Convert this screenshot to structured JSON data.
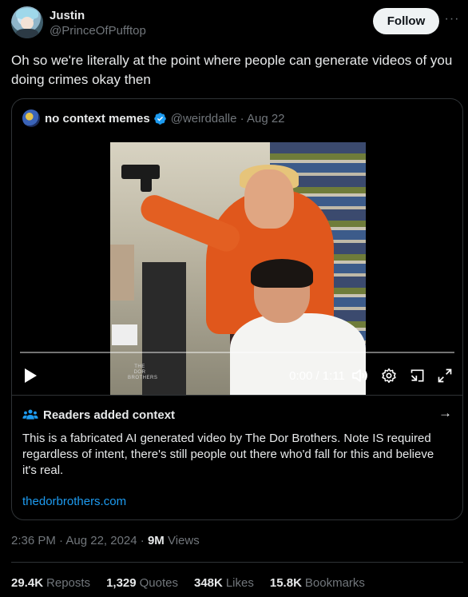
{
  "post": {
    "author_name": "Justin",
    "author_handle": "@PrinceOfPufftop",
    "follow_label": "Follow",
    "more_label": "···",
    "text": "Oh so we're literally at the point where people can generate videos of you doing crimes okay then"
  },
  "quote": {
    "author_name": "no context memes",
    "handle_date": "@weirddalle · Aug 22",
    "video": {
      "time": "0:00 / 1:11",
      "watermark": "THE DOR BROTHERS",
      "progress": 0
    }
  },
  "context": {
    "title": "Readers added context",
    "arrow": "→",
    "body": "This is a fabricated AI generated video by The Dor Brothers. Note IS required regardless of intent, there's still people out there who'd fall for this and believe it's real.",
    "link": "thedorbrothers.com"
  },
  "meta": {
    "timestamp": "2:36 PM · Aug 22, 2024 · ",
    "views_count": "9M",
    "views_label": " Views"
  },
  "stats": [
    {
      "num": "29.4K",
      "label": "Reposts"
    },
    {
      "num": "1,329",
      "label": "Quotes"
    },
    {
      "num": "348K",
      "label": "Likes"
    },
    {
      "num": "15.8K",
      "label": "Bookmarks"
    }
  ],
  "colors": {
    "background": "#000000",
    "text": "#e7e9ea",
    "muted": "#71767b",
    "link": "#1d9bf0",
    "verified": "#1d9bf0",
    "border": "#2f3336"
  },
  "icons": [
    "avatar",
    "more-icon",
    "verified-badge-icon",
    "play-icon",
    "volume-icon",
    "settings-icon",
    "pip-icon",
    "fullscreen-icon",
    "people-icon",
    "arrow-right-icon"
  ]
}
